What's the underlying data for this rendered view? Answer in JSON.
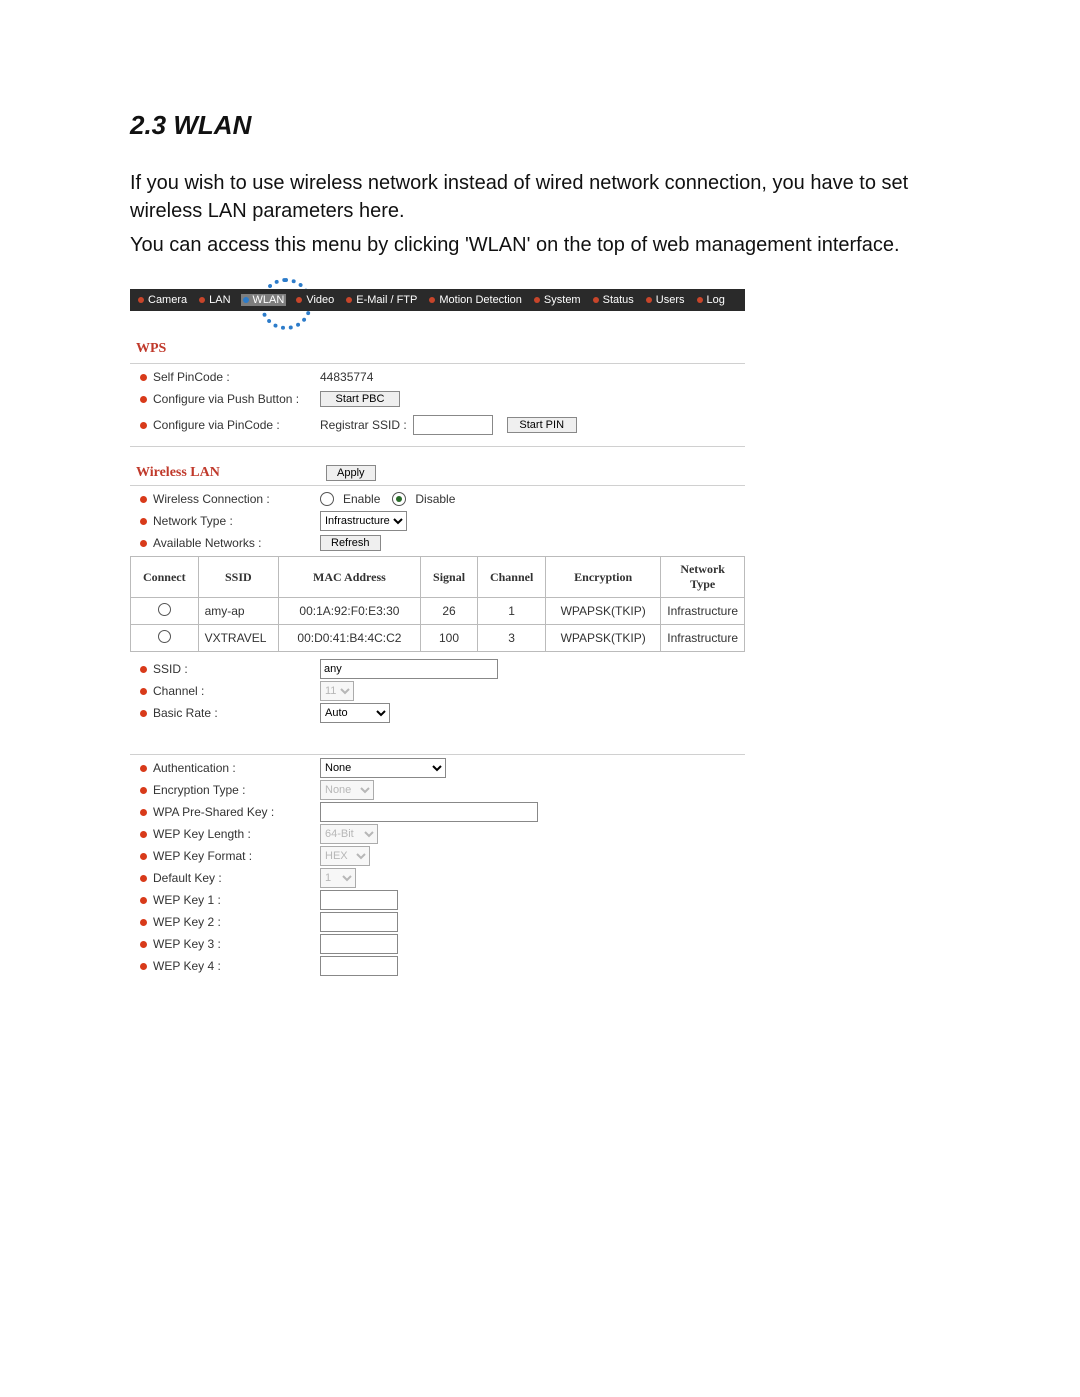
{
  "heading": "2.3 WLAN",
  "intro1": "If you wish to use wireless network instead of wired network connection, you have to set wireless LAN parameters here.",
  "intro2": "You can access this menu by clicking 'WLAN' on the top of web management interface.",
  "nav": {
    "items": [
      {
        "label": "Camera"
      },
      {
        "label": "LAN"
      },
      {
        "label": "WLAN"
      },
      {
        "label": "Video"
      },
      {
        "label": "E-Mail / FTP"
      },
      {
        "label": "Motion Detection"
      },
      {
        "label": "System"
      },
      {
        "label": "Status"
      },
      {
        "label": "Users"
      },
      {
        "label": "Log"
      }
    ]
  },
  "wps": {
    "title": "WPS",
    "self_pin_label": "Self PinCode :",
    "self_pin_value": "44835774",
    "push_btn_label": "Configure via Push Button :",
    "push_btn_button": "Start PBC",
    "pin_label": "Configure via PinCode :",
    "registrar_label": "Registrar SSID :",
    "registrar_value": "",
    "start_pin_button": "Start PIN"
  },
  "wlan": {
    "title": "Wireless LAN",
    "apply_button": "Apply",
    "conn_label": "Wireless Connection :",
    "enable_label": "Enable",
    "disable_label": "Disable",
    "nettype_label": "Network Type :",
    "nettype_value": "Infrastructure",
    "avail_label": "Available Networks :",
    "refresh_button": "Refresh",
    "table": {
      "headers": [
        "Connect",
        "SSID",
        "MAC Address",
        "Signal",
        "Channel",
        "Encryption",
        "Network Type"
      ],
      "rows": [
        {
          "ssid": "amy-ap",
          "mac": "00:1A:92:F0:E3:30",
          "signal": "26",
          "channel": "1",
          "enc": "WPAPSK(TKIP)",
          "ntype": "Infrastructure"
        },
        {
          "ssid": "VXTRAVEL",
          "mac": "00:D0:41:B4:4C:C2",
          "signal": "100",
          "channel": "3",
          "enc": "WPAPSK(TKIP)",
          "ntype": "Infrastructure"
        }
      ]
    },
    "ssid_label": "SSID :",
    "ssid_value": "any",
    "channel_label": "Channel :",
    "channel_value": "11",
    "basic_rate_label": "Basic Rate :",
    "basic_rate_value": "Auto"
  },
  "sec": {
    "auth_label": "Authentication :",
    "auth_value": "None",
    "enc_label": "Encryption Type :",
    "enc_value": "None",
    "wpa_label": "WPA Pre-Shared Key :",
    "wpa_value": "",
    "wep_len_label": "WEP Key Length :",
    "wep_len_value": "64-Bit",
    "wep_fmt_label": "WEP Key Format :",
    "wep_fmt_value": "HEX",
    "def_key_label": "Default Key :",
    "def_key_value": "1",
    "wep1_label": "WEP Key 1 :",
    "wep2_label": "WEP Key 2 :",
    "wep3_label": "WEP Key 3 :",
    "wep4_label": "WEP Key 4 :",
    "wep_value": ""
  }
}
